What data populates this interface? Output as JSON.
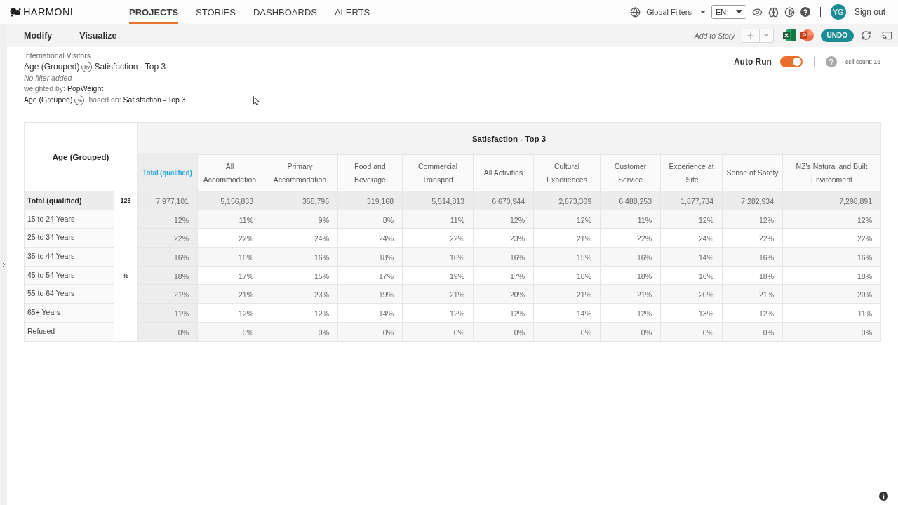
{
  "app": {
    "logo": "HARMONI"
  },
  "nav": [
    {
      "label": "PROJECTS",
      "selected": true
    },
    {
      "label": "STORIES",
      "selected": false
    },
    {
      "label": "DASHBOARDS",
      "selected": false
    },
    {
      "label": "ALERTS",
      "selected": false
    }
  ],
  "header_tools": {
    "global_filters": "Global Filters",
    "language": "EN",
    "avatar": "YG",
    "sign_out": "Sign out"
  },
  "toolbar": {
    "tabs": [
      "Modify",
      "Visualize"
    ],
    "add_to_story": "Add to Story",
    "undo": "UNDO"
  },
  "report": {
    "dataset": "International Visitors",
    "row_variable": "Age (Grouped)",
    "by_marker": "by",
    "column_variable": "Satisfaction - Top 3",
    "filter": "No filter added",
    "weighted_by_label": "weighted by:",
    "weight": "PopWeight",
    "base_variable": "Age (Grouped)",
    "base_marker": "%",
    "based_on_label": "based on:",
    "based_on": "Satisfaction - Top 3"
  },
  "auto_run": {
    "label": "Auto Run",
    "on": true
  },
  "cell_count": "cell count: 16",
  "table": {
    "row_header": "Age (Grouped)",
    "column_header": "Satisfaction - Top 3",
    "columns": [
      {
        "label": "Total (qualified)",
        "kind": "total"
      },
      {
        "label": "All Accommodation",
        "kind": "category"
      },
      {
        "label": "Primary Accommodation",
        "kind": "category"
      },
      {
        "label": "Food and Beverage",
        "kind": "category"
      },
      {
        "label": "Commercial Transport",
        "kind": "category"
      },
      {
        "label": "All Activities",
        "kind": "category"
      },
      {
        "label": "Cultural Experiences",
        "kind": "category"
      },
      {
        "label": "Customer Service",
        "kind": "category"
      },
      {
        "label": "Experience at iSite",
        "kind": "category"
      },
      {
        "label": "Sense of Safety",
        "kind": "category"
      },
      {
        "label": "NZ's Natural and Built Environment",
        "kind": "category"
      }
    ],
    "total_row": {
      "label": "Total (qualified)",
      "unit": "123",
      "values": [
        "7,977,101",
        "5,156,833",
        "358,796",
        "319,168",
        "5,514,813",
        "6,670,944",
        "2,673,369",
        "6,488,253",
        "1,877,784",
        "7,282,934",
        "7,298,891"
      ]
    },
    "unit": "%",
    "rows": [
      {
        "label": "15 to 24 Years",
        "values": [
          "12%",
          "11%",
          "9%",
          "8%",
          "11%",
          "12%",
          "12%",
          "11%",
          "12%",
          "12%",
          "12%"
        ]
      },
      {
        "label": "25 to 34 Years",
        "values": [
          "22%",
          "22%",
          "24%",
          "24%",
          "22%",
          "23%",
          "21%",
          "22%",
          "24%",
          "22%",
          "22%"
        ]
      },
      {
        "label": "35 to 44 Years",
        "values": [
          "16%",
          "16%",
          "16%",
          "18%",
          "16%",
          "16%",
          "15%",
          "16%",
          "14%",
          "16%",
          "16%"
        ]
      },
      {
        "label": "45 to 54 Years",
        "values": [
          "18%",
          "17%",
          "15%",
          "17%",
          "19%",
          "17%",
          "18%",
          "18%",
          "16%",
          "18%",
          "18%"
        ]
      },
      {
        "label": "55 to 64 Years",
        "values": [
          "21%",
          "21%",
          "23%",
          "19%",
          "21%",
          "20%",
          "21%",
          "21%",
          "20%",
          "21%",
          "20%"
        ]
      },
      {
        "label": "65+ Years",
        "values": [
          "11%",
          "12%",
          "12%",
          "14%",
          "12%",
          "12%",
          "14%",
          "12%",
          "13%",
          "12%",
          "11%"
        ]
      },
      {
        "label": "Refused",
        "values": [
          "0%",
          "0%",
          "0%",
          "0%",
          "0%",
          "0%",
          "0%",
          "0%",
          "0%",
          "0%",
          "0%"
        ]
      }
    ]
  }
}
